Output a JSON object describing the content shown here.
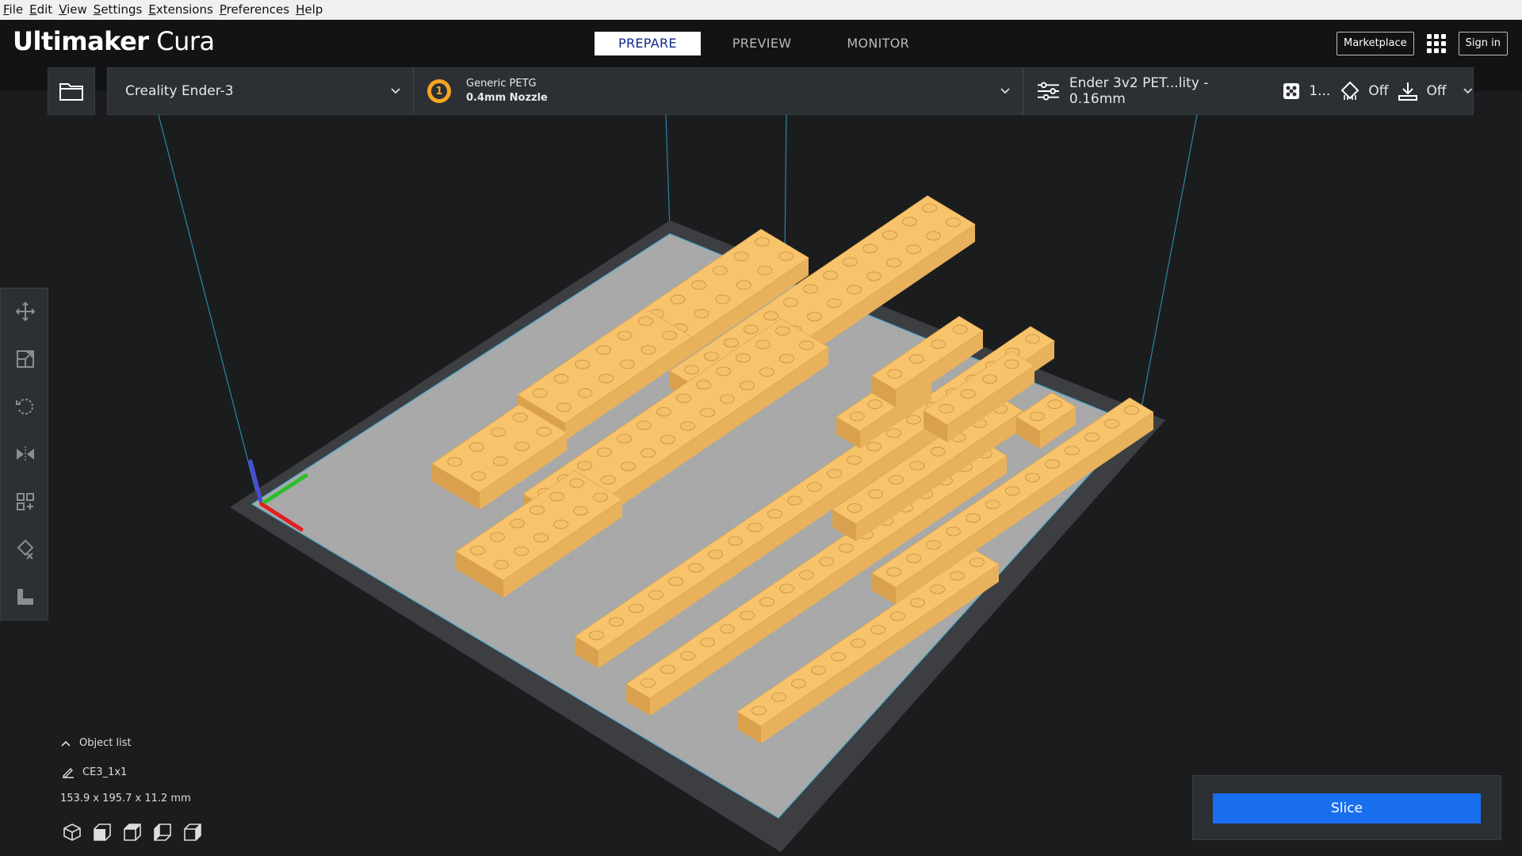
{
  "menu": [
    {
      "label": "File",
      "u": "F",
      "rest": "ile"
    },
    {
      "label": "Edit",
      "u": "E",
      "rest": "dit"
    },
    {
      "label": "View",
      "u": "V",
      "rest": "iew"
    },
    {
      "label": "Settings",
      "u": "S",
      "rest": "ettings"
    },
    {
      "label": "Extensions",
      "u": "E",
      "rest": "xtensions"
    },
    {
      "label": "Preferences",
      "u": "P",
      "rest": "references"
    },
    {
      "label": "Help",
      "u": "H",
      "rest": "elp"
    }
  ],
  "app": {
    "brand_bold": "Ultimaker",
    "brand_light": "Cura"
  },
  "stages": {
    "prepare": "PREPARE",
    "preview": "PREVIEW",
    "monitor": "MONITOR",
    "active": "PREPARE"
  },
  "header": {
    "marketplace": "Marketplace",
    "signin": "Sign in"
  },
  "toolbar": {
    "printer": "Creality Ender-3",
    "extruder_number": "1",
    "material": "Generic PETG",
    "nozzle": "0.4mm Nozzle",
    "profile": "Ender 3v2 PET...lity - 0.16mm",
    "infill": "1...",
    "support": "Off",
    "adhesion": "Off"
  },
  "objects": {
    "header": "Object list",
    "selected": "CE3_1x1",
    "dimensions": "153.9 x 195.7 x 11.2 mm"
  },
  "slice": {
    "label": "Slice"
  },
  "colors": {
    "accent": "#196ef0",
    "model": "#f7c46b",
    "plate": "#a9a9a9",
    "frame": "#3c3e42"
  }
}
